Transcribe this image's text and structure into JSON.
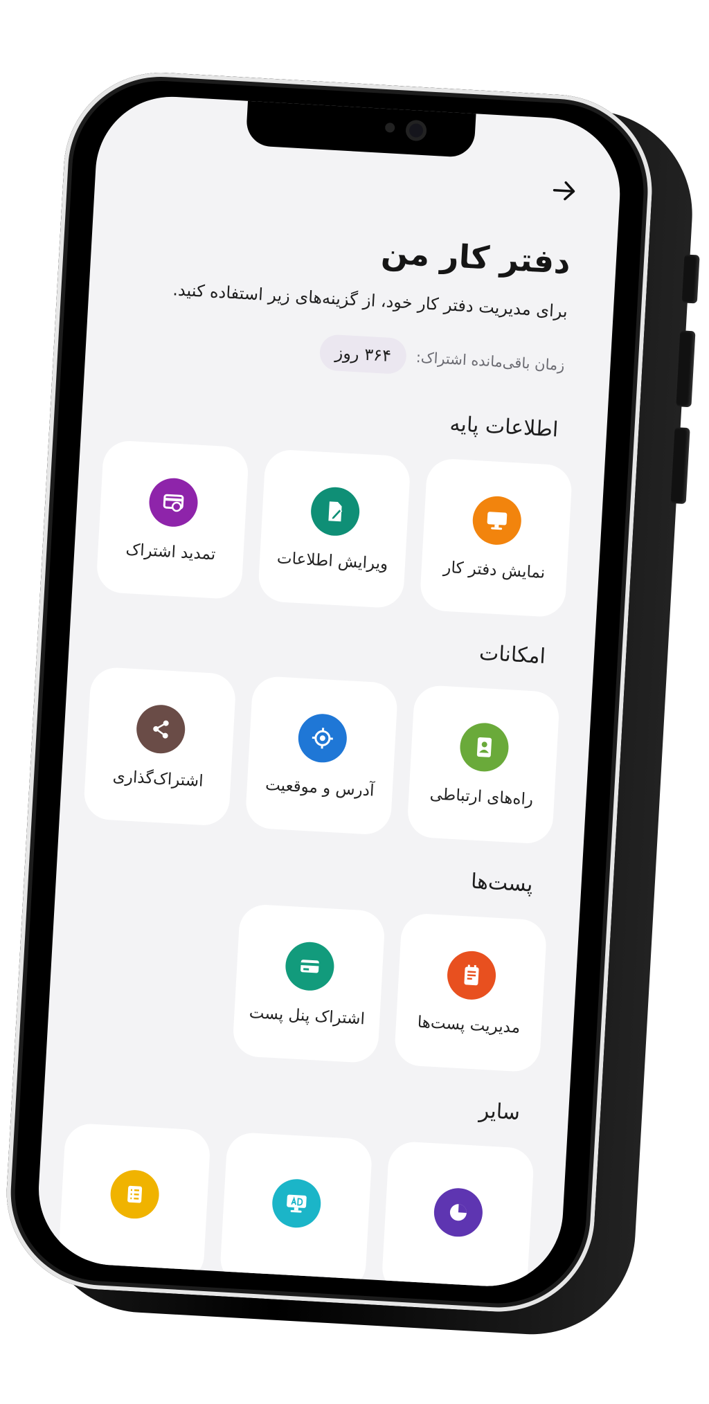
{
  "header": {
    "title": "دفتر کار من",
    "description": "برای مدیریت دفتر کار خود، از گزینه‌های زیر استفاده کنید.",
    "subscription_label": "زمان باقی‌مانده اشتراک:",
    "subscription_value": "۳۶۴ روز"
  },
  "sections": [
    {
      "title": "اطلاعات پایه",
      "items": [
        {
          "label": "نمایش دفتر کار",
          "icon": "monitor-icon",
          "color": "#f2840d"
        },
        {
          "label": "ویرایش اطلاعات",
          "icon": "edit-document-icon",
          "color": "#0f8f76"
        },
        {
          "label": "تمدید اشتراک",
          "icon": "renew-card-icon",
          "color": "#8e24aa"
        }
      ]
    },
    {
      "title": "امکانات",
      "items": [
        {
          "label": "راه‌های ارتباطی",
          "icon": "contact-book-icon",
          "color": "#6aaa3a"
        },
        {
          "label": "آدرس و موقعیت",
          "icon": "location-target-icon",
          "color": "#1f77d6"
        },
        {
          "label": "اشتراک‌گذاری",
          "icon": "share-icon",
          "color": "#6a4c47"
        }
      ]
    },
    {
      "title": "پست‌ها",
      "items": [
        {
          "label": "مدیریت پست‌ها",
          "icon": "notepad-icon",
          "color": "#e8501f"
        },
        {
          "label": "اشتراک پنل پست",
          "icon": "card-icon",
          "color": "#129b7c"
        }
      ]
    },
    {
      "title": "سایر",
      "items": [
        {
          "label": "",
          "icon": "pie-chart-icon",
          "color": "#5e35b1"
        },
        {
          "label": "",
          "icon": "ad-monitor-icon",
          "color": "#1bb5c8"
        },
        {
          "label": "",
          "icon": "list-icon",
          "color": "#f0b300"
        }
      ]
    }
  ],
  "colors": {
    "screen_bg": "#f3f3f5",
    "tile_bg": "#ffffff",
    "pill_bg": "#ebe7f0"
  }
}
